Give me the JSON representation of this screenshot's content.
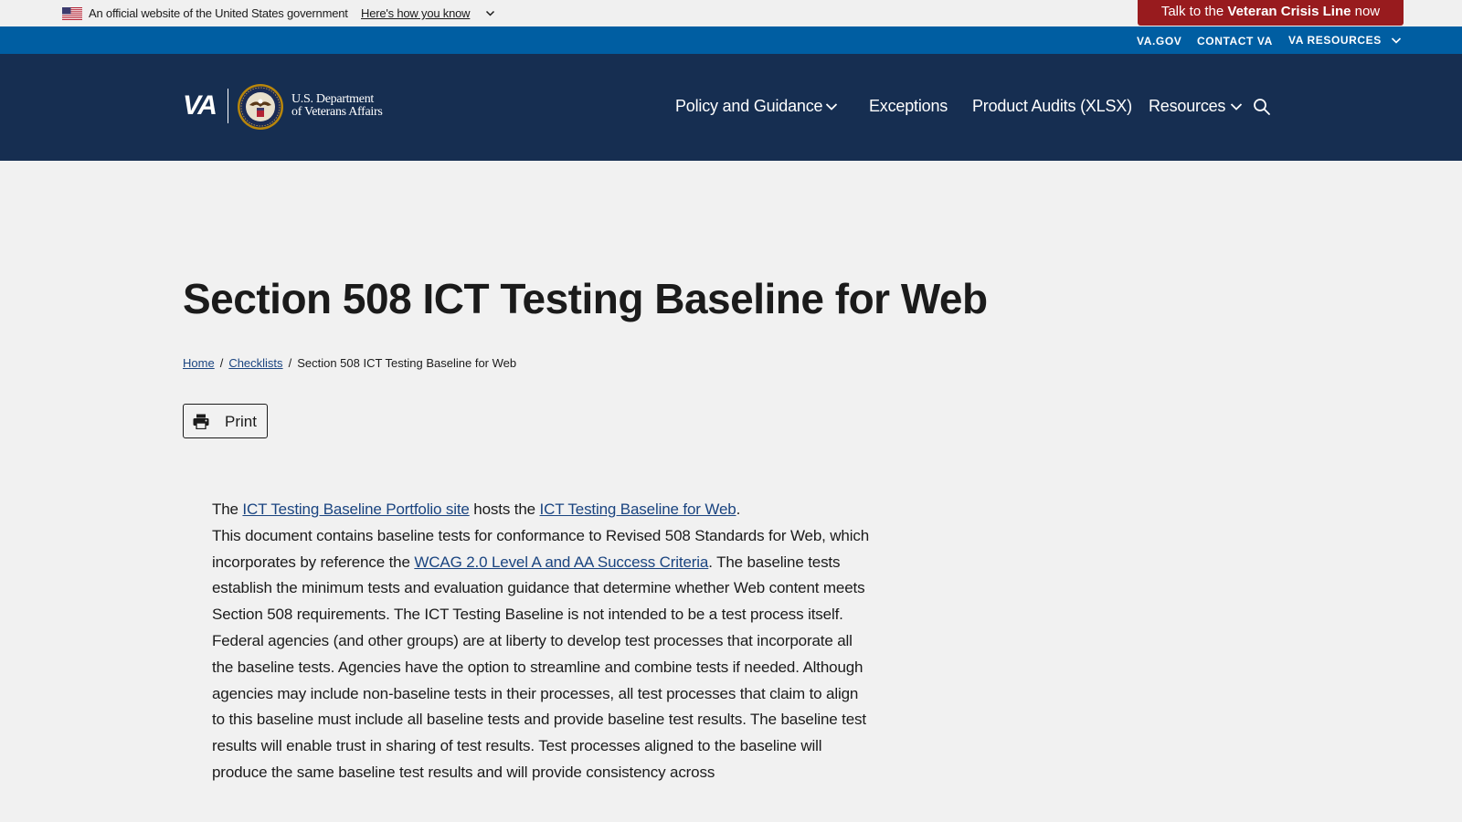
{
  "gov_banner": {
    "text": "An official website of the United States government",
    "link": "Here's how you know"
  },
  "crisis_line": {
    "prefix": "Talk to the ",
    "bold": "Veteran Crisis Line",
    "suffix": " now"
  },
  "utility_nav": {
    "vagov": "VA.GOV",
    "contact": "CONTACT VA",
    "resources": "VA RESOURCES"
  },
  "logo": {
    "va": "VA",
    "dept_line1": "U.S. Department",
    "dept_line2": "of Veterans Affairs"
  },
  "main_nav": {
    "policy": "Policy and Guidance",
    "exceptions": "Exceptions",
    "audits": "Product Audits (XLSX)",
    "resources": "Resources"
  },
  "page": {
    "title": "Section 508 ICT Testing Baseline for Web"
  },
  "breadcrumb": {
    "home": "Home",
    "checklists": "Checklists",
    "current": "Section 508 ICT Testing Baseline for Web"
  },
  "print": {
    "label": "Print"
  },
  "content": {
    "p1_a": "The ",
    "p1_link1": "ICT Testing Baseline Portfolio site",
    "p1_b": " hosts the ",
    "p1_link2": "ICT Testing Baseline for Web",
    "p1_c": ".",
    "p2_a": "This document contains baseline tests for conformance to Revised 508 Standards for Web, which incorporates by reference the ",
    "p2_link": "WCAG 2.0 Level A and AA Success Criteria",
    "p2_b": ". The baseline tests establish the minimum tests and evaluation guidance that determine whether Web content meets Section 508 requirements. The ICT Testing Baseline is not intended to be a test process itself.",
    "p3": "Federal agencies (and other groups) are at liberty to develop test processes that incorporate all the baseline tests. Agencies have the option to streamline and combine tests if needed. Although agencies may include non-baseline tests in their processes, all test processes that claim to align to this baseline must include all baseline tests and provide baseline test results. The baseline test results will enable trust in sharing of test results. Test processes aligned to the baseline will produce the same baseline test results and will provide consistency across"
  },
  "colors": {
    "gov_banner_bg": "#f0f0f0",
    "crisis_bg": "#981b1e",
    "utility_bg": "#005ea2",
    "header_bg": "#162e51",
    "page_bg": "#f1f1f1",
    "link": "#1a4480"
  },
  "icons": {
    "flag": "us-flag-icon",
    "chevron": "chevron-down-icon",
    "search": "search-icon",
    "print": "printer-icon",
    "seal": "va-seal-icon"
  }
}
